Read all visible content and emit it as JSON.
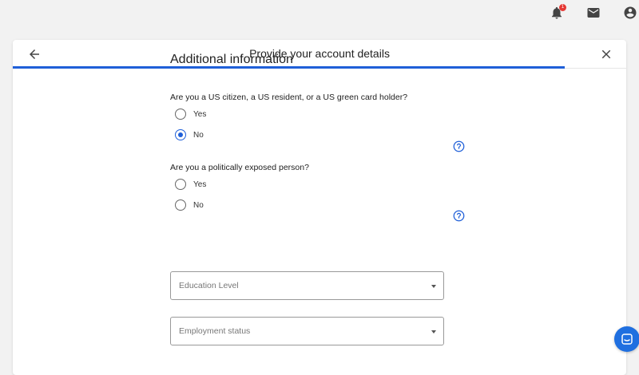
{
  "topbar": {
    "notification_count": "1",
    "colors": {
      "badge": "#e53935",
      "icon": "#444444"
    }
  },
  "dialog": {
    "title": "Provide your account details",
    "progress_fraction": 0.9,
    "accent_color": "#1f5fd8"
  },
  "form": {
    "section_title": "Additional information",
    "questions": [
      {
        "text": "Are you a US citizen, a US resident, or a US green card holder?",
        "options": [
          {
            "label": "Yes",
            "checked": false
          },
          {
            "label": "No",
            "checked": true
          }
        ]
      },
      {
        "text": "Are you a politically exposed person?",
        "options": [
          {
            "label": "Yes",
            "checked": false
          },
          {
            "label": "No",
            "checked": false
          }
        ]
      }
    ],
    "selects": [
      {
        "placeholder": "Education Level"
      },
      {
        "placeholder": "Employment status"
      }
    ]
  },
  "icons": {
    "notifications": "bell-icon",
    "messages": "mail-icon",
    "account": "account-circle-icon",
    "back": "arrow-left-icon",
    "close": "close-icon",
    "help": "help-icon",
    "chat": "chat-icon"
  }
}
